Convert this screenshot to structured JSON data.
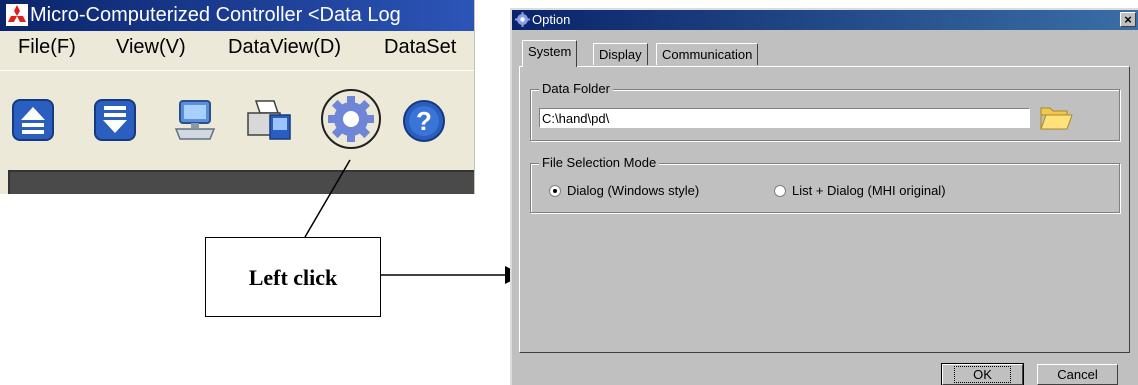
{
  "main_window": {
    "title": "Micro-Computerized Controller <Data Log",
    "menu": [
      "File(F)",
      "View(V)",
      "DataView(D)",
      "DataSet"
    ],
    "toolbar": {
      "icons": [
        "upload-icon",
        "download-icon",
        "monitor-keyboard-icon",
        "printer-icon",
        "gear-icon",
        "help-icon"
      ],
      "gear_highlighted": true
    }
  },
  "annotation": {
    "callout_text": "Left click"
  },
  "option_dialog": {
    "title": "Option",
    "close_symbol": "×",
    "tabs": [
      "System",
      "Display",
      "Communication"
    ],
    "active_tab": "System",
    "data_folder": {
      "label": "Data Folder",
      "value": "C:\\hand\\pd\\"
    },
    "file_selection_mode": {
      "label": "File Selection Mode",
      "options": [
        "Dialog (Windows style)",
        "List + Dialog (MHI original)"
      ],
      "selected": "Dialog (Windows style)"
    },
    "buttons": {
      "ok": "OK",
      "cancel": "Cancel"
    }
  },
  "colors": {
    "title_bar": "#0a246a",
    "dialog_bg": "#c0c0c0",
    "window_bg": "#ece9d8",
    "toolbar_blue": "#2a5fc0"
  }
}
